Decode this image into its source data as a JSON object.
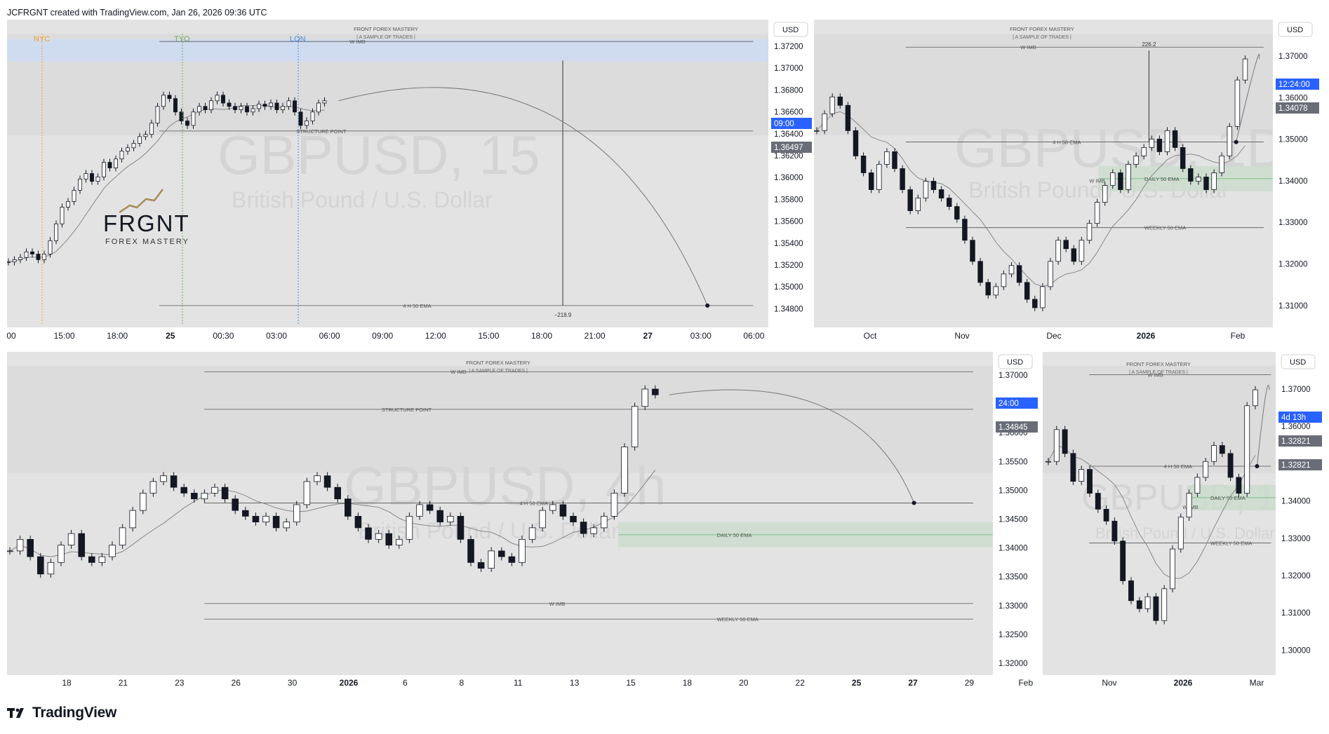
{
  "header": {
    "credit": "JCFRGNT created with TradingView.com, Jan 26, 2026 09:36 UTC"
  },
  "footer": {
    "brand": "TradingView"
  },
  "colors": {
    "bg": "#e3e3e3",
    "price_label_blue": "#2962ff",
    "price_label_gray": "#6a6d78",
    "green_zone": "#c9dccb",
    "green_line": "#7fbf8a",
    "blue_zone": "#cfdcef",
    "session_nyc": "#f0a030",
    "session_tyo": "#6fa85a",
    "session_lon": "#4d8fd6"
  },
  "panels": [
    {
      "id": "p1",
      "currency": "USD",
      "watermark_symbol": "GBPUSD, 15",
      "watermark_name": "British Pound / U.S. Dollar",
      "brand_title": "FRONT FOREX MASTERY",
      "brand_subtitle": "| A SAMPLE OF TRADES |",
      "logo_main": "FRGNT",
      "logo_sub": "FOREX MASTERY",
      "sessions": [
        "NYC",
        "TYO",
        "LON"
      ],
      "annotations": {
        "w_imb": "W IMB",
        "structure": "STRUCTURE POINT",
        "ema4h": "4 H 50 EMA",
        "measure": "−218.9"
      },
      "y_ticks": [
        "1.37200",
        "1.37000",
        "1.36800",
        "1.36600",
        "1.36400",
        "1.36200",
        "1.36000",
        "1.35800",
        "1.35600",
        "1.35400",
        "1.35200",
        "1.35000",
        "1.34800"
      ],
      "price_labels": [
        {
          "text": "09:00",
          "kind": "blue"
        },
        {
          "text": "1.36497",
          "kind": "gray"
        }
      ],
      "x_ticks": [
        "00",
        "15:00",
        "18:00",
        "25",
        "00:30",
        "03:00",
        "06:00",
        "09:00",
        "12:00",
        "15:00",
        "18:00",
        "21:00",
        "27",
        "03:00",
        "06:00"
      ]
    },
    {
      "id": "p2",
      "currency": "USD",
      "watermark_symbol": "GBPUSD, 1D",
      "watermark_name": "British Pound / U.S. Dollar",
      "brand_title": "FRONT FOREX MASTERY",
      "brand_subtitle": "| A SAMPLE OF TRADES |",
      "annotations": {
        "w_imb_top": "W IMB",
        "measure": "226.2",
        "ema4h": "4 H 50 EMA",
        "daily": "DAILY 50 EMA",
        "w_imb_mid": "W IMB",
        "weekly": "WEEKLY 50 EMA"
      },
      "y_ticks": [
        "1.37000",
        "1.36000",
        "1.35000",
        "1.34000",
        "1.33000",
        "1.32000",
        "1.31000"
      ],
      "price_labels": [
        {
          "text": "12:24:00",
          "kind": "blue"
        },
        {
          "text": "1.34078",
          "kind": "gray"
        }
      ],
      "x_ticks": [
        "Oct",
        "Nov",
        "Dec",
        "2026",
        "Feb"
      ]
    },
    {
      "id": "p3",
      "currency": "USD",
      "watermark_symbol": "GBPUSD, 4h",
      "watermark_name": "British Pound / U.S. Dollar",
      "brand_title": "FRONT FOREX MASTERY",
      "brand_subtitle": "| A SAMPLE OF TRADES |",
      "annotations": {
        "w_imb_top": "W IMB",
        "structure": "STRUCTURE POINT",
        "ema4h": "4 H 50 EMA",
        "daily": "DAILY 50 EMA",
        "w_imb_low": "W IMB",
        "weekly": "WEEKLY 50 EMA"
      },
      "y_ticks": [
        "1.37000",
        "1.36500",
        "1.36000",
        "1.35500",
        "1.35000",
        "1.34500",
        "1.34000",
        "1.33500",
        "1.33000",
        "1.32500",
        "1.32000"
      ],
      "price_labels": [
        {
          "text": "24:00",
          "kind": "blue"
        },
        {
          "text": "1.34845",
          "kind": "gray"
        }
      ],
      "x_ticks": [
        "18",
        "21",
        "23",
        "26",
        "30",
        "2026",
        "6",
        "8",
        "11",
        "13",
        "15",
        "18",
        "20",
        "22",
        "25",
        "27",
        "29",
        "Feb"
      ]
    },
    {
      "id": "p4",
      "currency": "USD",
      "watermark_symbol": "GBPUSD, 1W",
      "watermark_name": "British Pound / U.S. Dollar",
      "brand_title": "FRONT FOREX MASTERY",
      "brand_subtitle": "| A SAMPLE OF TRADES |",
      "annotations": {
        "w_imb_top": "W IMB",
        "ema4h": "4 H 50 EMA",
        "daily": "DAILY 50 EMA",
        "w_imb_mid": "W IMB",
        "weekly": "WEEKLY 50 EMA"
      },
      "y_ticks": [
        "1.37000",
        "1.36000",
        "1.35000",
        "1.34000",
        "1.33000",
        "1.32000",
        "1.31000",
        "1.30000"
      ],
      "price_labels": [
        {
          "text": "4d 13h",
          "kind": "blue"
        },
        {
          "text": "1.32821",
          "kind": "gray"
        },
        {
          "text": "1.32821",
          "kind": "gray"
        }
      ],
      "x_ticks": [
        "Nov",
        "2026",
        "Mar"
      ]
    }
  ],
  "chart_data": [
    {
      "type": "candlestick",
      "title": "GBPUSD, 15",
      "ylim": [
        1.347,
        1.373
      ],
      "x_ticks": [
        "00",
        "15:00",
        "18:00",
        "25",
        "00:30",
        "03:00",
        "06:00",
        "09:00",
        "12:00",
        "15:00",
        "18:00",
        "21:00",
        "27",
        "03:00",
        "06:00"
      ],
      "approx_close_path": [
        1.3526,
        1.3528,
        1.353,
        1.3535,
        1.3533,
        1.3528,
        1.3533,
        1.3545,
        1.356,
        1.3575,
        1.358,
        1.359,
        1.36,
        1.3605,
        1.3598,
        1.3602,
        1.3615,
        1.361,
        1.3618,
        1.3625,
        1.3628,
        1.3632,
        1.3638,
        1.364,
        1.365,
        1.3665,
        1.3675,
        1.3672,
        1.366,
        1.3652,
        1.3648,
        1.366,
        1.3665,
        1.3662,
        1.367,
        1.3675,
        1.3668,
        1.3665,
        1.3662,
        1.3665,
        1.366,
        1.3663,
        1.3667,
        1.3665,
        1.3668,
        1.3662,
        1.3665,
        1.367,
        1.366,
        1.3648,
        1.3652,
        1.366,
        1.3668,
        1.367
      ],
      "levels": {
        "w_imb": 1.3723,
        "structure_point": 1.3643,
        "ema_4h_50": 1.3487,
        "current": 1.36497
      },
      "measure": {
        "from": 1.3706,
        "to": 1.3487,
        "label": "−218.9"
      }
    },
    {
      "type": "candlestick",
      "title": "GBPUSD, 1D",
      "ylim": [
        1.306,
        1.375
      ],
      "x_ticks": [
        "Oct",
        "Nov",
        "Dec",
        "2026",
        "Feb"
      ],
      "approx_close_path": [
        1.352,
        1.356,
        1.36,
        1.358,
        1.352,
        1.346,
        1.342,
        1.338,
        1.344,
        1.347,
        1.343,
        1.338,
        1.333,
        1.336,
        1.34,
        1.338,
        1.336,
        1.334,
        1.331,
        1.326,
        1.321,
        1.316,
        1.313,
        1.315,
        1.318,
        1.32,
        1.316,
        1.312,
        1.31,
        1.315,
        1.321,
        1.326,
        1.324,
        1.321,
        1.326,
        1.33,
        1.335,
        1.339,
        1.342,
        1.338,
        1.344,
        1.346,
        1.348,
        1.35,
        1.347,
        1.352,
        1.348,
        1.343,
        1.34,
        1.341,
        1.338,
        1.342,
        1.346,
        1.353,
        1.364,
        1.369
      ],
      "levels": {
        "w_imb": 1.3718,
        "ema_4h_50": 1.3493,
        "daily_50_ema": 1.3406,
        "weekly_50_ema": 1.329,
        "current": 1.34078
      },
      "measure": {
        "from": 1.3493,
        "to": 1.371,
        "label": "226.2"
      }
    },
    {
      "type": "candlestick",
      "title": "GBPUSD, 4h",
      "ylim": [
        1.319,
        1.372
      ],
      "x_ticks": [
        "18",
        "21",
        "23",
        "26",
        "30",
        "2026",
        "6",
        "8",
        "11",
        "13",
        "15",
        "18",
        "20",
        "22",
        "25",
        "27",
        "29",
        "Feb"
      ],
      "approx_close_path": [
        1.34,
        1.342,
        1.339,
        1.336,
        1.338,
        1.341,
        1.343,
        1.339,
        1.338,
        1.339,
        1.341,
        1.344,
        1.347,
        1.35,
        1.352,
        1.353,
        1.351,
        1.35,
        1.349,
        1.35,
        1.351,
        1.349,
        1.347,
        1.346,
        1.345,
        1.346,
        1.344,
        1.345,
        1.348,
        1.352,
        1.353,
        1.351,
        1.349,
        1.346,
        1.344,
        1.342,
        1.343,
        1.341,
        1.342,
        1.346,
        1.348,
        1.347,
        1.345,
        1.346,
        1.342,
        1.338,
        1.337,
        1.34,
        1.339,
        1.338,
        1.342,
        1.344,
        1.347,
        1.348,
        1.346,
        1.345,
        1.343,
        1.344,
        1.346,
        1.35,
        1.358,
        1.365,
        1.368,
        1.367
      ],
      "levels": {
        "w_imb": 1.371,
        "structure_point": 1.3645,
        "ema_4h_50": 1.3483,
        "daily_50_ema": 1.3428,
        "w_imb_low": 1.3309,
        "weekly_50_ema": 1.3282,
        "current": 1.34845
      }
    },
    {
      "type": "candlestick",
      "title": "GBPUSD, 1W",
      "ylim": [
        1.297,
        1.374
      ],
      "x_ticks": [
        "Nov",
        "2026",
        "Mar"
      ],
      "approx_close_path": [
        1.35,
        1.358,
        1.352,
        1.345,
        1.348,
        1.342,
        1.338,
        1.335,
        1.33,
        1.32,
        1.315,
        1.313,
        1.316,
        1.31,
        1.318,
        1.328,
        1.336,
        1.342,
        1.346,
        1.35,
        1.354,
        1.352,
        1.346,
        1.342,
        1.364,
        1.368
      ],
      "levels": {
        "w_imb": 1.3718,
        "ema_4h_50": 1.3488,
        "daily_50_ema": 1.3409,
        "weekly_50_ema": 1.3295,
        "current": 1.32821
      }
    }
  ]
}
